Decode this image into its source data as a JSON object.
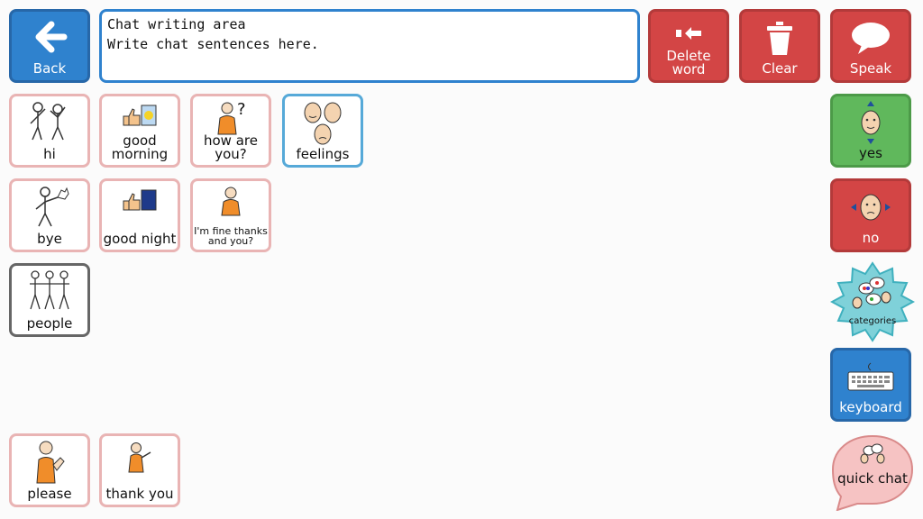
{
  "toolbar": {
    "back_label": "Back",
    "chat_title": "Chat writing area",
    "chat_placeholder": "Write chat sentences here.",
    "delete_word_label": "Delete word",
    "clear_label": "Clear",
    "speak_label": "Speak"
  },
  "grid": {
    "hi": "hi",
    "good_morning": "good morning",
    "how_are_you": "how are you?",
    "feelings": "feelings",
    "bye": "bye",
    "good_night": "good night",
    "im_fine": "I'm fine thanks and you?",
    "people": "people",
    "please": "please",
    "thank_you": "thank you"
  },
  "side": {
    "yes": "yes",
    "no": "no",
    "categories": "categories",
    "keyboard": "keyboard",
    "quick_chat": "quick chat"
  },
  "colors": {
    "red": "#d34545",
    "blue": "#2f82ce",
    "green": "#60b85c",
    "pink_border": "#e9b4b4"
  }
}
